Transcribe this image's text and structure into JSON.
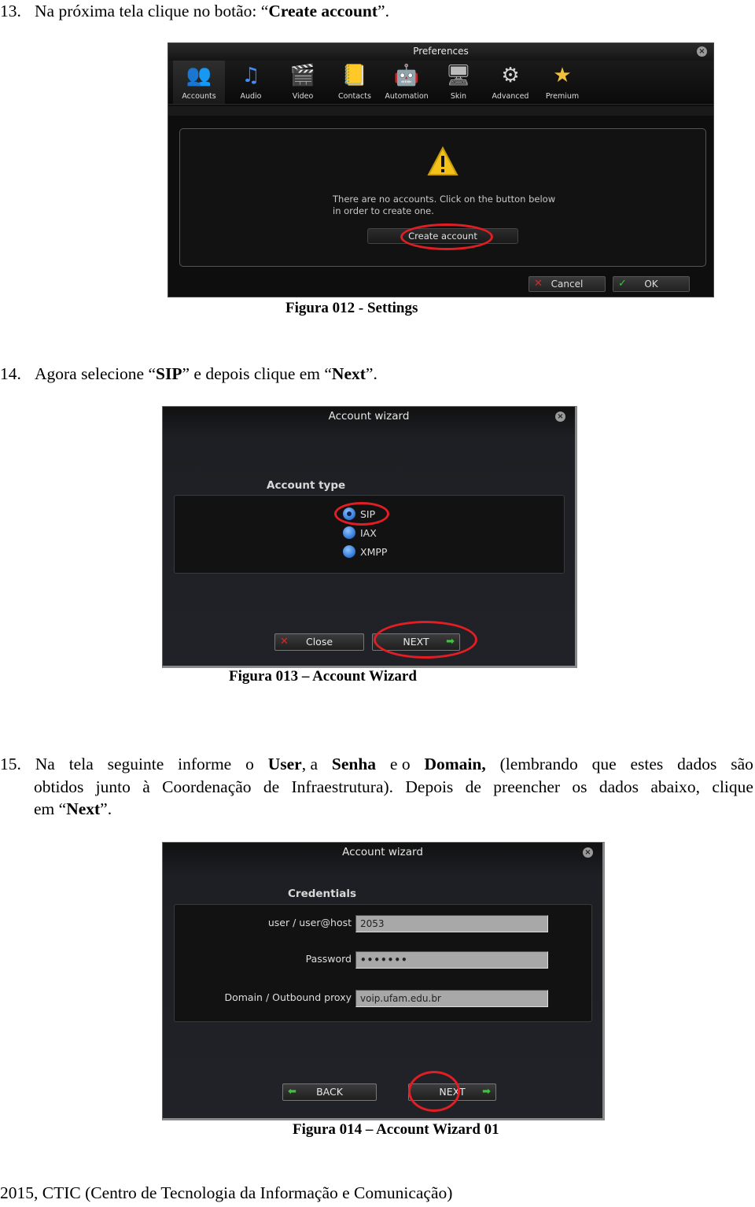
{
  "step13": {
    "number": "13.",
    "text_before": "Na próxima tela clique no botão: “",
    "bold": "Create account",
    "text_after": "”."
  },
  "figure12": {
    "caption": "Figura 012 - Settings",
    "window_title": "Preferences",
    "toolbar": [
      {
        "label": "Accounts",
        "icon": "accounts-icon",
        "glyph": "👥",
        "active": true
      },
      {
        "label": "Audio",
        "icon": "music-note-icon",
        "glyph": "♫",
        "active": false
      },
      {
        "label": "Video",
        "icon": "clapperboard-icon",
        "glyph": "🎬",
        "active": false
      },
      {
        "label": "Contacts",
        "icon": "address-book-icon",
        "glyph": "📒",
        "active": false
      },
      {
        "label": "Automation",
        "icon": "robot-icon",
        "glyph": "🤖",
        "active": false
      },
      {
        "label": "Skin",
        "icon": "monitor-icon",
        "glyph": "🖥",
        "active": false
      },
      {
        "label": "Advanced",
        "icon": "gear-icon",
        "glyph": "⚙",
        "active": false
      },
      {
        "label": "Premium",
        "icon": "star-icon",
        "glyph": "★",
        "active": false
      }
    ],
    "message_line1": "There are no accounts. Click on the button below",
    "message_line2": "in order to create one.",
    "create_button": "Create account",
    "cancel_button": "Cancel",
    "ok_button": "OK",
    "cancel_glyph": "✕",
    "ok_glyph": "✓",
    "close_glyph": "×"
  },
  "step14": {
    "number": "14.",
    "t1": "Agora selecione “",
    "b1": "SIP",
    "t2": "” e depois clique em “",
    "b2": "Next",
    "t3": "”."
  },
  "figure13": {
    "caption": "Figura 013 – Account Wizard",
    "window_title": "Account wizard",
    "section_title": "Account type",
    "options": [
      {
        "label": "SIP",
        "checked": true
      },
      {
        "label": "IAX",
        "checked": false
      },
      {
        "label": "XMPP",
        "checked": false
      }
    ],
    "close_button": "Close",
    "next_button": "NEXT",
    "close_glyph": "✕",
    "next_glyph": "➡"
  },
  "step15": {
    "number": "15.",
    "w": [
      "Na",
      "tela",
      "seguinte",
      "informe",
      "o"
    ],
    "b_user": "User",
    "t_a": ", a",
    "b_senha": "Senha",
    "t_e_o": "e o",
    "b_domain": "Domain,",
    "t_rest1": [
      "(lembrando",
      "que",
      "estes",
      "dados",
      "são"
    ],
    "line2_words": [
      "obtidos",
      "junto",
      "à",
      "Coordenação",
      "de",
      "Infraestrutura).",
      "Depois",
      "de",
      "preencher",
      "os",
      "dados",
      "abaixo,",
      "clique"
    ],
    "line3_before": "em “",
    "line3_bold": "Next",
    "line3_after": "”."
  },
  "figure14": {
    "caption": "Figura 014 – Account Wizard 01",
    "window_title": "Account wizard",
    "section_title": "Credentials",
    "fields": [
      {
        "label": "user / user@host",
        "value": "2053"
      },
      {
        "label": "Password",
        "value": "•••••••"
      },
      {
        "label": "Domain / Outbound proxy",
        "value": "voip.ufam.edu.br"
      }
    ],
    "back_button": "BACK",
    "next_button": "NEXT",
    "back_glyph": "⬅",
    "next_glyph": "➡"
  },
  "footer": "2015, CTIC (Centro de Tecnologia da Informação e Comunicação)",
  "colors": {
    "highlight_red": "#e01e24",
    "radio_blue": "#3a7fd8",
    "arrow_green": "#3cc43c",
    "x_red": "#e02424"
  }
}
